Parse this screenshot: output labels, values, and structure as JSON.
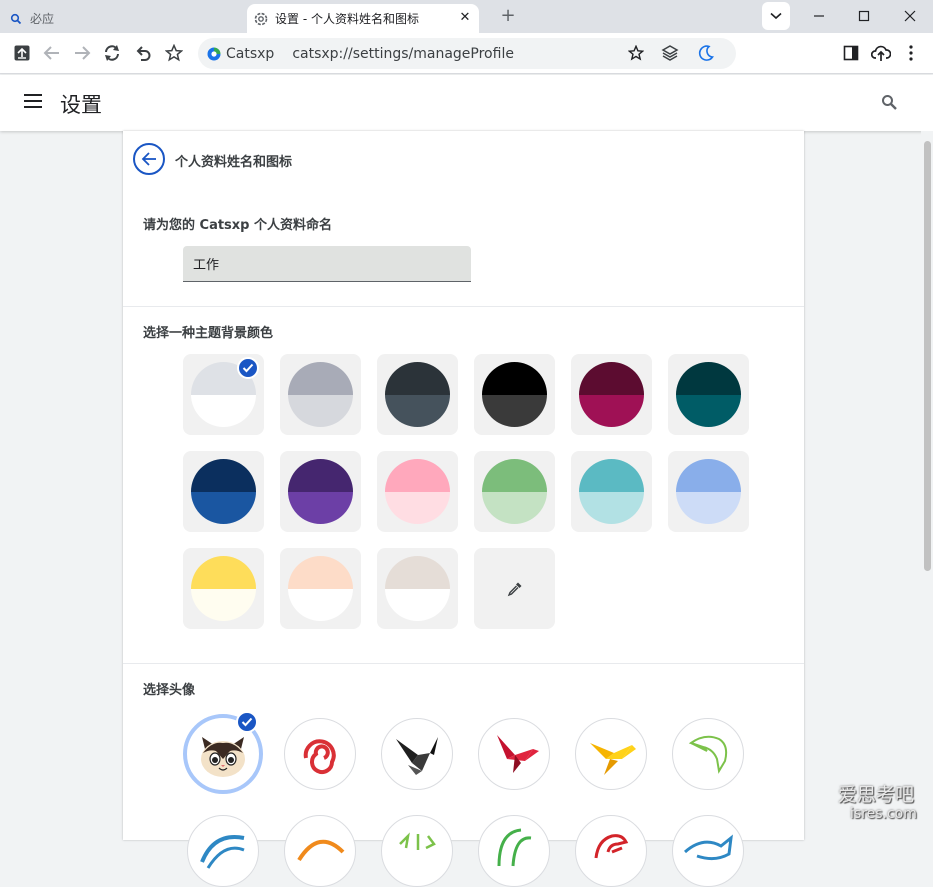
{
  "tabs": [
    {
      "title": "必应",
      "active": false
    },
    {
      "title": "设置 - 个人资料姓名和图标",
      "active": true
    }
  ],
  "toolbar": {
    "brand_name": "Catsxp",
    "url": "catsxp://settings/manageProfile"
  },
  "header": {
    "title": "设置"
  },
  "page": {
    "subtitle": "个人资料姓名和图标",
    "name_label": "请为您的 Catsxp 个人资料命名",
    "name_value": "工作",
    "theme_label": "选择一种主题背景颜色",
    "avatar_label": "选择头像"
  },
  "themes": [
    {
      "top": "#dee1e6",
      "bottom": "#ffffff",
      "selected": true
    },
    {
      "top": "#a8abb7",
      "bottom": "#d6d8dd",
      "selected": false
    },
    {
      "top": "#2b3339",
      "bottom": "#45525c",
      "selected": false
    },
    {
      "top": "#000000",
      "bottom": "#3a3a3a",
      "selected": false
    },
    {
      "top": "#5c0c30",
      "bottom": "#9f1155",
      "selected": false
    },
    {
      "top": "#00383f",
      "bottom": "#005c66",
      "selected": false
    },
    {
      "top": "#0b2f5e",
      "bottom": "#1a56a1",
      "selected": false
    },
    {
      "top": "#45266f",
      "bottom": "#6c3fa6",
      "selected": false
    },
    {
      "top": "#ffa8bc",
      "bottom": "#ffdde3",
      "selected": false
    },
    {
      "top": "#7cbd7b",
      "bottom": "#c4e2c3",
      "selected": false
    },
    {
      "top": "#5bbac3",
      "bottom": "#b2e1e4",
      "selected": false
    },
    {
      "top": "#89aeea",
      "bottom": "#cddcf7",
      "selected": false
    },
    {
      "top": "#fedd5a",
      "bottom": "#fffdf0",
      "selected": false
    },
    {
      "top": "#fddcc8",
      "bottom": "#ffffff",
      "selected": false
    },
    {
      "top": "#e5ddd7",
      "bottom": "#ffffff",
      "selected": false
    }
  ],
  "custom_color_icon": "eyedropper-icon",
  "avatars": [
    {
      "name": "cat",
      "selected": true
    },
    {
      "name": "red-swirl",
      "selected": false
    },
    {
      "name": "origami-crane",
      "selected": false
    },
    {
      "name": "red-bird",
      "selected": false
    },
    {
      "name": "yellow-bird",
      "selected": false
    },
    {
      "name": "green-toucan",
      "selected": false
    },
    {
      "name": "blue-arc",
      "selected": false
    },
    {
      "name": "orange-arc",
      "selected": false
    },
    {
      "name": "green-flowers",
      "selected": false
    },
    {
      "name": "green-ball",
      "selected": false
    },
    {
      "name": "red-dragon",
      "selected": false
    },
    {
      "name": "blue-fish",
      "selected": false
    }
  ],
  "colors": {
    "accent": "#1a56c4",
    "selection_ring": "#a8c7fa"
  },
  "watermark": {
    "line1": "爱思考吧",
    "line2": "isres.com"
  }
}
